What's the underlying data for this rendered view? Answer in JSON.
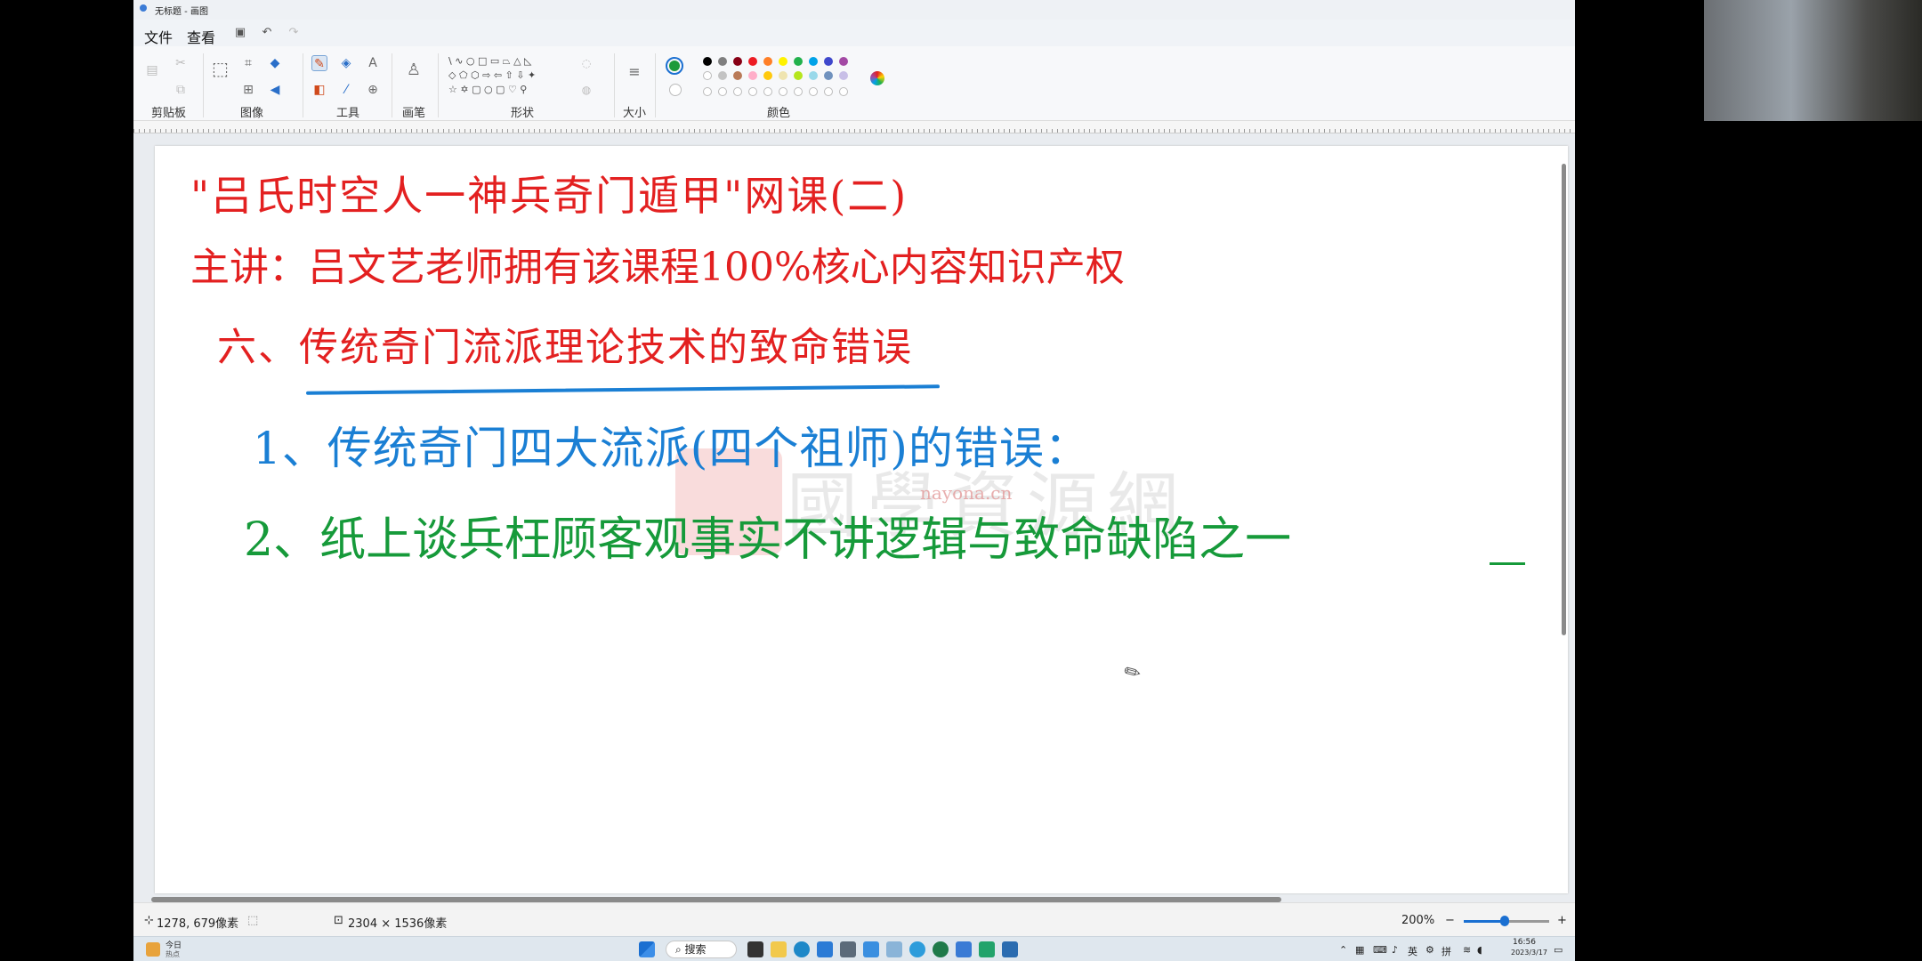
{
  "window": {
    "title": "无标题 - 画图"
  },
  "menu": {
    "file": "文件",
    "view": "查看"
  },
  "ribbon": {
    "groups": [
      "剪贴板",
      "图像",
      "工具",
      "画笔",
      "形状",
      "大小",
      "颜色"
    ]
  },
  "colors": {
    "primary": "#1e9a3a",
    "palette_row1": [
      "#000000",
      "#7f7f7f",
      "#880015",
      "#ed1c24",
      "#ff7f27",
      "#fff200",
      "#22b14c",
      "#00a2e8",
      "#3f48cc",
      "#a349a4"
    ],
    "palette_row2": [
      "#ffffff",
      "#c3c3c3",
      "#b97a57",
      "#ffaec9",
      "#ffc90e",
      "#efe4b0",
      "#b5e61d",
      "#99d9ea",
      "#7092be",
      "#c8bfe7"
    ]
  },
  "canvas": {
    "lines": [
      {
        "text": "\"吕氏时空人一神兵奇门遁甲\"网课(二)",
        "color": "red"
      },
      {
        "text": "主讲：吕文艺老师拥有该课程100%核心内容知识产权",
        "color": "red"
      },
      {
        "text": "六、传统奇门流派理论技术的致命错误",
        "color": "red"
      },
      {
        "text": "1、传统奇门四大流派(四个祖师)的错误：",
        "color": "blue"
      },
      {
        "text": "2、纸上谈兵枉顾客观事实不讲逻辑与致命缺陷之一",
        "color": "green"
      }
    ],
    "watermark": "nayona.cn",
    "watermark_big": "國學資源網"
  },
  "status": {
    "cursor_pos": "1278, 679像素",
    "canvas_size": "2304 × 1536像素",
    "zoom": "200%",
    "zoom_level": 0.48
  },
  "taskbar": {
    "weather_line1": "今日",
    "weather_line2": "热点",
    "search": "搜索",
    "ime": "英",
    "ime2": "拼",
    "time": "16:56",
    "date": "2023/3/17"
  }
}
